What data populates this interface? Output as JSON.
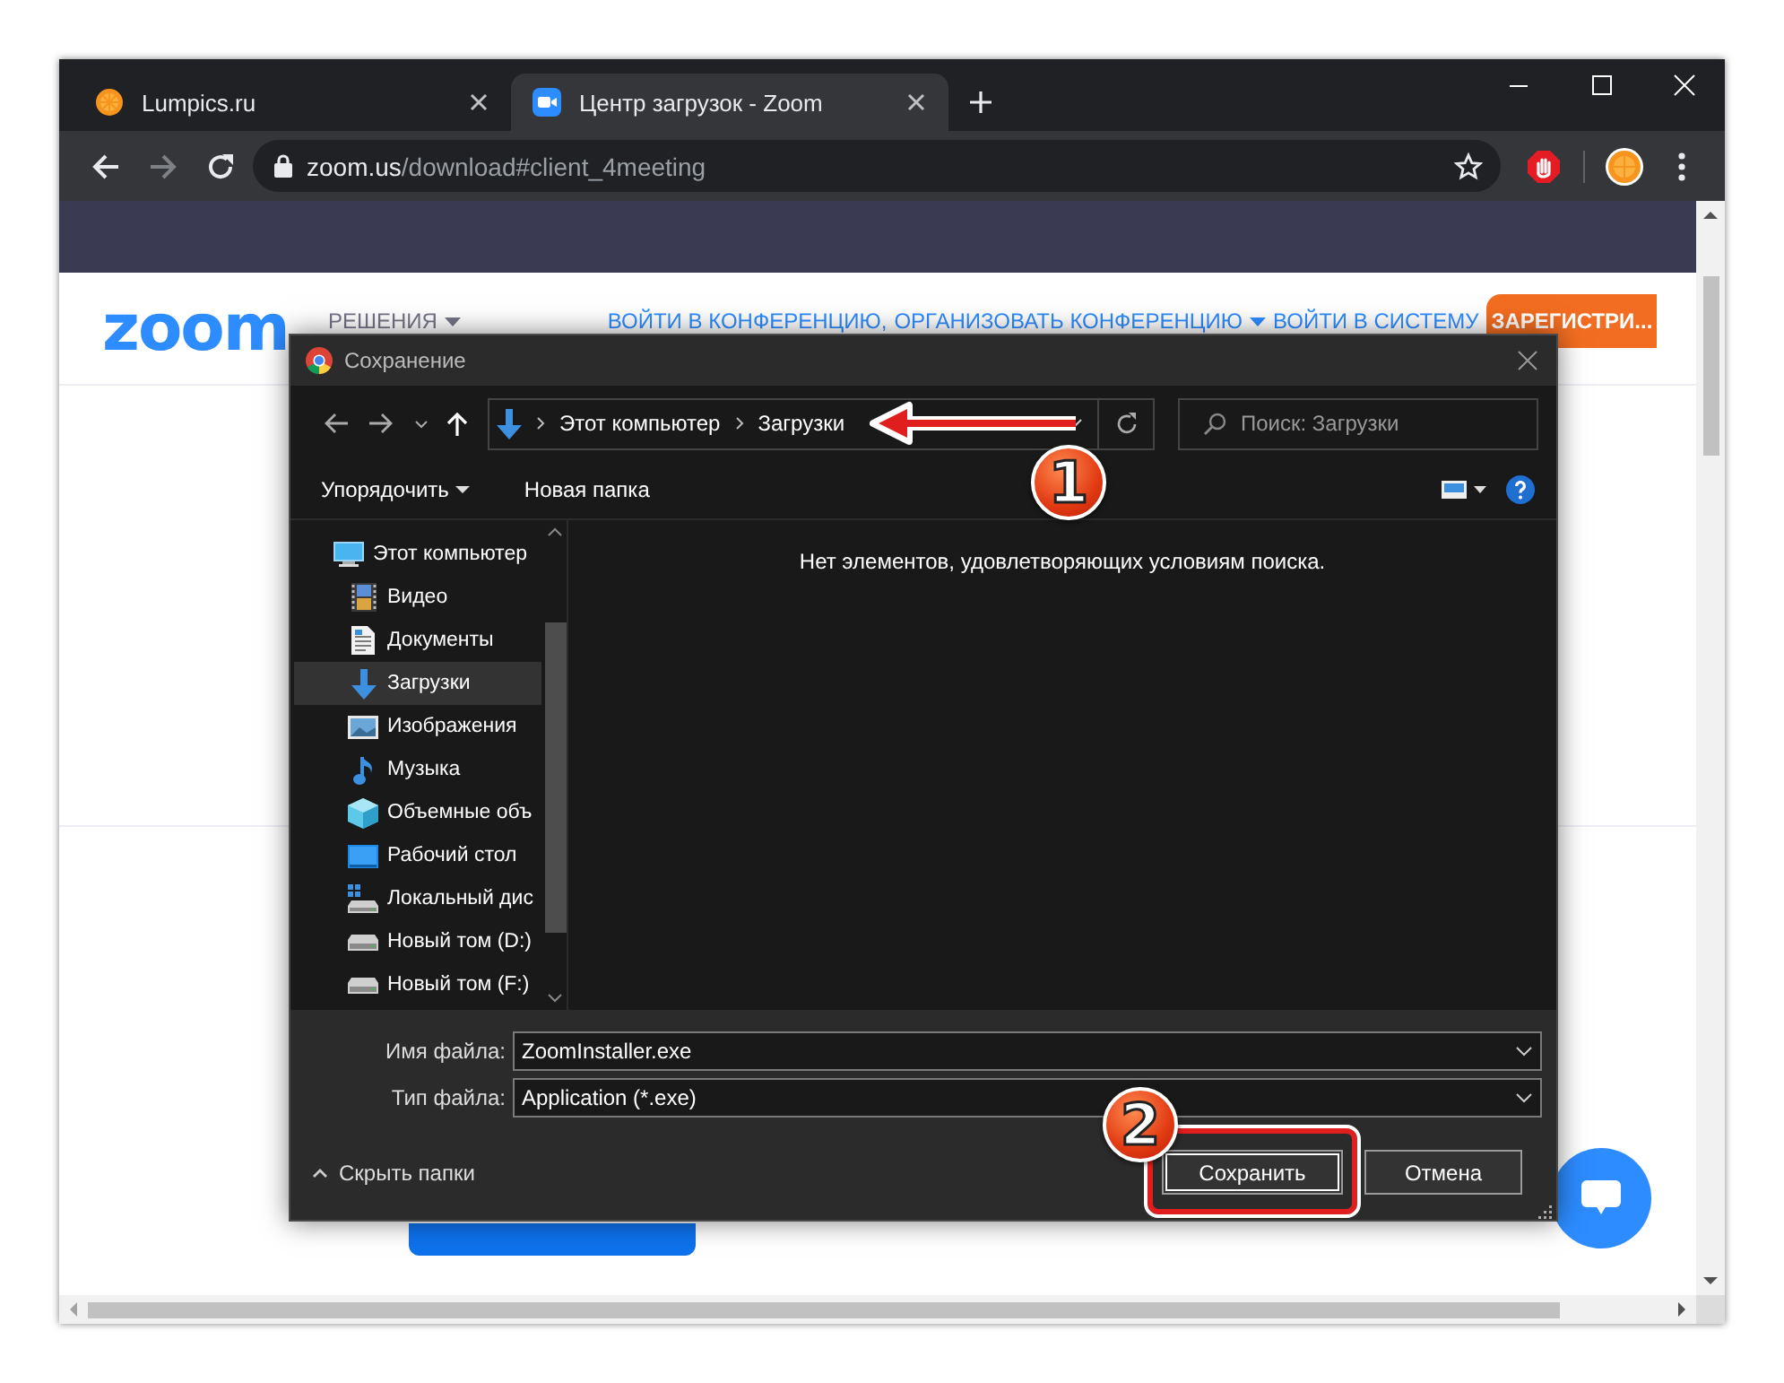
{
  "browser": {
    "tabs": [
      {
        "title": "Lumpics.ru",
        "kind": "orange",
        "selected": false
      },
      {
        "title": "Центр загрузок - Zoom",
        "kind": "zoom",
        "selected": true
      }
    ],
    "url_host": "zoom.us",
    "url_path": "/download#client_4meeting"
  },
  "page": {
    "logo": "zoom",
    "nav": [
      {
        "label": "РЕШЕНИЯ",
        "kind": "menu"
      },
      {
        "label": "ВОЙТИ В КОНФЕРЕНЦИЮ,",
        "kind": "link"
      },
      {
        "label": "ОРГАНИЗОВАТЬ КОНФЕРЕНЦИЮ",
        "kind": "link-menu"
      },
      {
        "label": "ВОЙТИ В СИСТЕМУ",
        "kind": "link"
      }
    ],
    "signup": "ЗАРЕГИСТРИ..."
  },
  "dialog": {
    "title": "Сохранение",
    "path": [
      "Этот компьютер",
      "Загрузки"
    ],
    "search": {
      "placeholder": "Поиск: Загрузки"
    },
    "toolbar": [
      {
        "label": "Упорядочить",
        "kind": "menu"
      },
      {
        "label": "Новая папка",
        "kind": "plain"
      }
    ],
    "nav_tree": [
      {
        "label": "Этот компьютер",
        "kind": "computer",
        "selected": false,
        "children": [
          {
            "label": "Видео",
            "kind": "video",
            "selected": false
          },
          {
            "label": "Документы",
            "kind": "documents",
            "selected": false
          },
          {
            "label": "Загрузки",
            "kind": "downloads",
            "selected": true
          },
          {
            "label": "Изображения",
            "kind": "pictures",
            "selected": false
          },
          {
            "label": "Музыка",
            "kind": "music",
            "selected": false
          },
          {
            "label": "Объемные объ",
            "kind": "objects",
            "selected": false
          },
          {
            "label": "Рабочий стол",
            "kind": "desktop",
            "selected": false
          },
          {
            "label": "Локальный дис",
            "kind": "system-disk",
            "selected": false
          },
          {
            "label": "Новый том (D:)",
            "kind": "disk",
            "selected": false
          },
          {
            "label": "Новый том (F:)",
            "kind": "disk",
            "selected": false
          }
        ]
      }
    ],
    "empty_message": "Нет элементов, удовлетворяющих условиям поиска.",
    "fields": [
      {
        "label": "Имя файла:",
        "value": "ZoomInstaller.exe"
      },
      {
        "label": "Тип файла:",
        "value": "Application (*.exe)"
      }
    ],
    "hide_folders": "Скрыть папки",
    "buttons": [
      {
        "label": "Сохранить",
        "kind": "primary"
      },
      {
        "label": "Отмена",
        "kind": "secondary"
      }
    ]
  },
  "annotations": [
    {
      "label": "1"
    },
    {
      "label": "2"
    }
  ]
}
